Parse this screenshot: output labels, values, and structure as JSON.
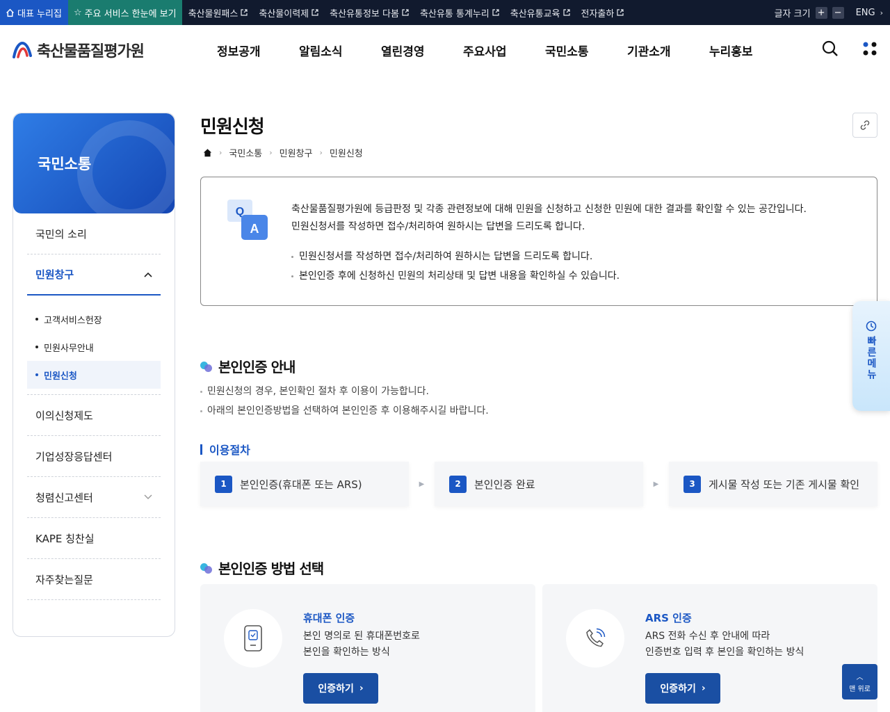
{
  "topbar": {
    "home": "대표 누리집",
    "service": "주요 서비스 한눈에 보기",
    "external": [
      "축산물원패스",
      "축산물이력제",
      "축산유통정보 다봄",
      "축산유통 통계누리",
      "축산유통교육",
      "전자출하"
    ],
    "font_size_label": "글자 크기",
    "plus": "+",
    "minus": "−",
    "lang": "ENG"
  },
  "header": {
    "logo": "축산물품질평가원",
    "gnb": [
      "정보공개",
      "알림소식",
      "열린경영",
      "주요사업",
      "국민소통",
      "기관소개",
      "누리홍보"
    ]
  },
  "sidebar": {
    "title": "국민소통",
    "items": [
      {
        "label": "국민의 소리"
      },
      {
        "label": "민원창구"
      },
      {
        "label": "이의신청제도"
      },
      {
        "label": "기업성장응답센터"
      },
      {
        "label": "청렴신고센터"
      },
      {
        "label": "KAPE 칭찬실"
      },
      {
        "label": "자주찾는질문"
      }
    ],
    "sub": [
      "고객서비스헌장",
      "민원사무안내",
      "민원신청"
    ]
  },
  "page": {
    "title": "민원신청",
    "breadcrumb": [
      "국민소통",
      "민원창구",
      "민원신청"
    ]
  },
  "intro": {
    "line1": "축산물품질평가원에 등급판정 및 각종 관련정보에 대해 민원을 신청하고 신청한 민원에 대한 결과를 확인할 수 있는 공간입니다.",
    "line2": "민원신청서를 작성하면 접수/처리하여 원하시는 답변을 드리도록 합니다.",
    "bullets": [
      "민원신청서를 작성하면 접수/처리하여 원하시는 답변을 드리도록 합니다.",
      "본인인증 후에 신청하신 민원의 처리상태 및 답변 내용을 확인하실 수 있습니다."
    ],
    "icon_q": "Q",
    "icon_a": "A"
  },
  "quick": {
    "label": "빠른메뉴"
  },
  "auth_guide": {
    "title": "본인인증 안내",
    "bullets": [
      "민원신청의 경우, 본인확인 절차 후 이용이 가능합니다.",
      "아래의 본인인증방법을 선택하여 본인인증 후 이용해주시길 바랍니다."
    ]
  },
  "procedure": {
    "title": "이용절차",
    "steps": [
      {
        "num": "1",
        "label": "본인인증(휴대폰 또는 ARS)"
      },
      {
        "num": "2",
        "label": "본인인증 완료"
      },
      {
        "num": "3",
        "label": "게시물 작성 또는 기존 게시물 확인"
      }
    ]
  },
  "auth_method": {
    "title": "본인인증 방법 선택",
    "cards": [
      {
        "title": "휴대폰 인증",
        "desc1": "본인 명의로 된 휴대폰번호로",
        "desc2": "본인을 확인하는 방식",
        "button": "인증하기"
      },
      {
        "title": "ARS 인증",
        "desc1": "ARS 전화 수신 후 안내에 따라",
        "desc2": "인증번호 입력 후 본인을 확인하는 방식",
        "button": "인증하기"
      }
    ]
  },
  "totop": {
    "label": "맨 위로"
  },
  "colors": {
    "primary": "#1b57c4",
    "topbar": "#111a2e",
    "service": "#1a7c6f",
    "button": "#1a4fa3"
  }
}
